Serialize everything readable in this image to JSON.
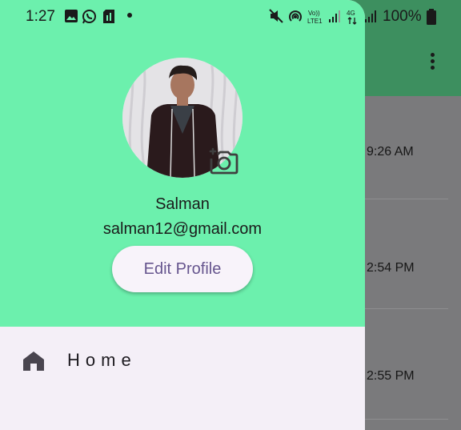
{
  "status_bar": {
    "time": "1:27",
    "battery": "100%",
    "icons": [
      "gallery-icon",
      "whatsapp-icon",
      "sim-icon",
      "dot-icon",
      "mute-icon",
      "hotspot-icon",
      "volte-icon",
      "signal-icon",
      "4g-icon",
      "signal-icon",
      "battery-icon"
    ]
  },
  "background": {
    "times": [
      "9:26 AM",
      "2:54 PM",
      "2:55 PM"
    ],
    "menu_icon": "more-vert-icon"
  },
  "drawer": {
    "header_color": "#6cf0ad",
    "user": {
      "name": "Salman",
      "email": "salman12@gmail.com"
    },
    "camera_icon": "add-photo-icon",
    "edit_button": "Edit Profile",
    "menu": [
      {
        "label": "Home",
        "icon": "home-icon"
      }
    ]
  }
}
